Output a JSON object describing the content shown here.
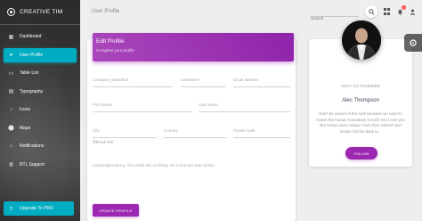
{
  "sidebar": {
    "brand": "CREATIVE TIM",
    "items": [
      {
        "label": "Dashboard",
        "icon": "dashboard-icon"
      },
      {
        "label": "User Profile",
        "icon": "person-icon"
      },
      {
        "label": "Table List",
        "icon": "content-paste-icon"
      },
      {
        "label": "Typography",
        "icon": "library-books-icon"
      },
      {
        "label": "Icons",
        "icon": "bubble-chart-icon"
      },
      {
        "label": "Maps",
        "icon": "location-icon"
      },
      {
        "label": "Notifications",
        "icon": "notifications-icon"
      },
      {
        "label": "RTL Support",
        "icon": "language-icon"
      }
    ],
    "upgrade_label": "Upgrade To PRO",
    "active_color": "#00acc1"
  },
  "topbar": {
    "title": "User Profile",
    "search_placeholder": "Search",
    "notification_count": "5"
  },
  "edit_profile": {
    "title": "Edit Profile",
    "subtitle": "Complete your profile",
    "fields": {
      "company": "Company (disabled)",
      "username": "Username",
      "email": "Email address",
      "first_name": "First Name",
      "last_name": "Last Name",
      "city": "City",
      "country": "Country",
      "postal_code": "Postal Code"
    },
    "about_label": "About me",
    "about_text": "Lamborghini Mercy, Your chick she so thirsty, I'm in that two seat Lambo.",
    "update_button": "UPDATE PROFILE",
    "accent": "#9c27b0"
  },
  "profile": {
    "title": "CEO / CO-FOUNDER",
    "name": "Alec Thompson",
    "bio": "Don't be scared of the truth because we need to restart the human foundation in truth And I love you like Kanye loves Kanye I love Rick Owens' bed design but the back is...",
    "follow_button": "FOLLOW"
  }
}
